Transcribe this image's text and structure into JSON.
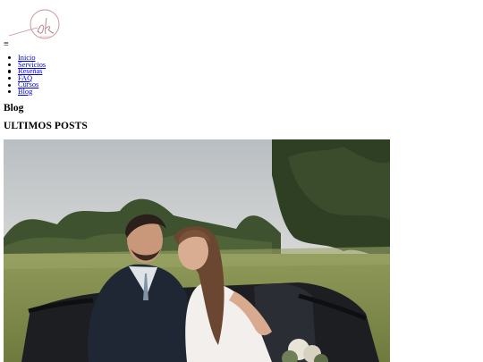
{
  "header": {
    "logo_monogram": "ek",
    "menu_icon": "hamburger-icon"
  },
  "nav": {
    "items": [
      {
        "label": "Inicio"
      },
      {
        "label": "Servicios"
      },
      {
        "label": "Reseñas"
      },
      {
        "label": "FAQ"
      },
      {
        "label": "Cursos"
      },
      {
        "label": "Blog"
      }
    ]
  },
  "main": {
    "page_title": "Blog",
    "section_title": "ULTIMOS POSTS"
  },
  "colors": {
    "link": "#0000ee",
    "logo_accent": "#c98f94"
  }
}
